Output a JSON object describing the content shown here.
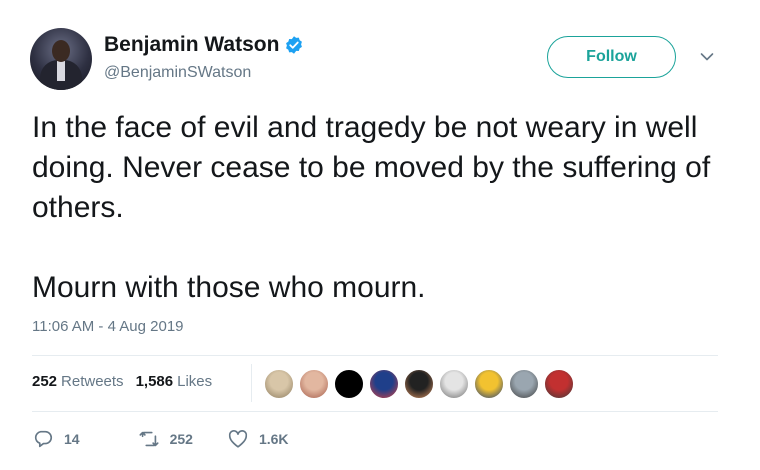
{
  "user": {
    "name": "Benjamin Watson",
    "handle": "@BenjaminSWatson",
    "verified": true
  },
  "follow_label": "Follow",
  "tweet": {
    "paragraphs": [
      "In the face of evil and tragedy be not weary in well doing. Never cease to be moved by the suffering of others.",
      "Mourn with those who mourn."
    ],
    "timestamp": "11:06 AM - 4 Aug 2019"
  },
  "stats": {
    "retweets_count": "252",
    "retweets_label": "Retweets",
    "likes_count": "1,586",
    "likes_label": "Likes"
  },
  "actions": {
    "reply_count": "14",
    "retweet_count": "252",
    "like_count": "1.6K"
  },
  "colors": {
    "accent": "#1ba39a",
    "verified": "#1da1f2",
    "muted": "#657786",
    "text": "#14171a"
  },
  "liker_avatars": [
    {
      "colors": [
        "#d8c6a8",
        "#8b7a5c"
      ]
    },
    {
      "colors": [
        "#e2b7a0",
        "#a35a48"
      ]
    },
    {
      "colors": [
        "#000000",
        "#000000"
      ]
    },
    {
      "colors": [
        "#1f3f8a",
        "#d84040"
      ]
    },
    {
      "colors": [
        "#222222",
        "#d89060"
      ]
    },
    {
      "colors": [
        "#e4e4e4",
        "#6a6a6a"
      ]
    },
    {
      "colors": [
        "#f2c230",
        "#1d3a7a"
      ]
    },
    {
      "colors": [
        "#9aa6b0",
        "#3a3a3a"
      ]
    },
    {
      "colors": [
        "#c23030",
        "#3a3a3a"
      ]
    }
  ]
}
